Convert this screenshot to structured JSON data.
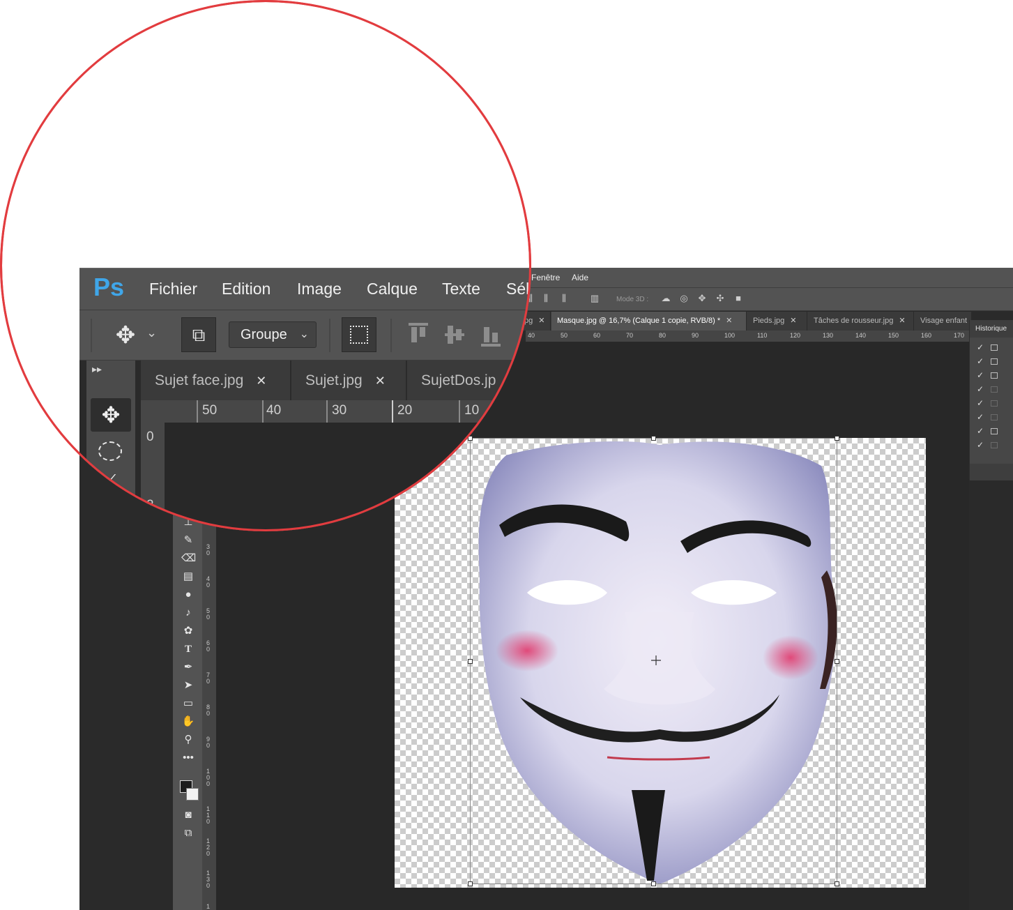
{
  "app": {
    "logo": "Ps",
    "accent": "#3fa6e9",
    "highlight_ring": "#e23c3f"
  },
  "menu": {
    "zoomed": [
      "Fichier",
      "Edition",
      "Image",
      "Calque",
      "Texte",
      "Sél"
    ],
    "small": [
      "Fenêtre",
      "Aide"
    ]
  },
  "options": {
    "autoselect_value": "Groupe",
    "mode3d": "Mode 3D :"
  },
  "zoomed_tabs": [
    {
      "label": "Sujet face.jpg",
      "close": "✕"
    },
    {
      "label": "Sujet.jpg",
      "close": "✕"
    },
    {
      "label": "SujetDos.jp"
    }
  ],
  "small_tabs": [
    {
      "label": "pg",
      "close": "✕"
    },
    {
      "label": "Masque.jpg @ 16,7% (Calque 1 copie, RVB/8) *",
      "close": "✕",
      "active": true
    },
    {
      "label": "Pieds.jpg",
      "close": "✕"
    },
    {
      "label": "Tâches de rousseur.jpg",
      "close": "✕"
    },
    {
      "label": "Visage enfant"
    }
  ],
  "zoomed_ruler": {
    "h": [
      "50",
      "40",
      "30",
      "20",
      "10"
    ],
    "v": [
      "0",
      "2"
    ]
  },
  "small_ruler": {
    "h": [
      "40",
      "50",
      "60",
      "70",
      "80",
      "90",
      "100",
      "110",
      "120",
      "130",
      "140",
      "150",
      "160",
      "170"
    ],
    "v": [
      "30",
      "40",
      "50",
      "60",
      "70",
      "80",
      "90",
      "100",
      "110",
      "120",
      "130",
      "1"
    ]
  },
  "history": {
    "title": "Historique",
    "rows": 8
  }
}
